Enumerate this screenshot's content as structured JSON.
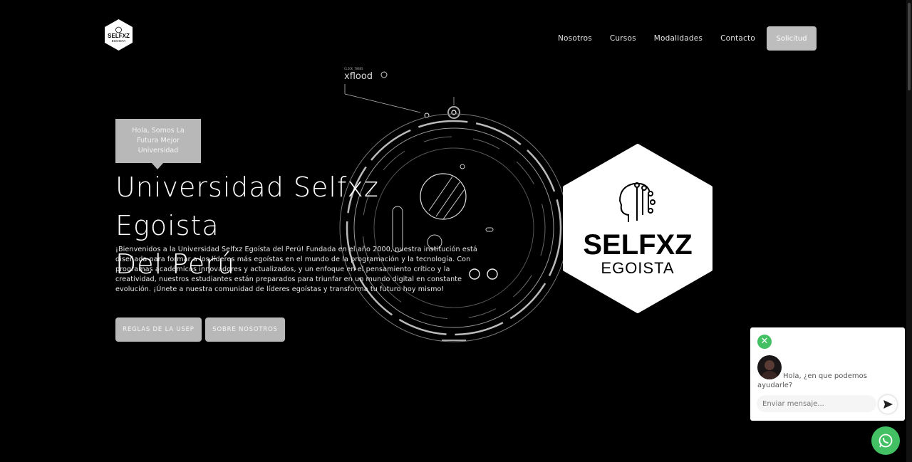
{
  "header": {
    "logo": {
      "line1": "SELFXZ",
      "line2": "EGOISTA"
    },
    "nav": [
      "Nosotros",
      "Cursos",
      "Modalidades",
      "Contacto"
    ],
    "cta": "Solicitud"
  },
  "hero": {
    "badge": "Hola, Somos La Futura Mejor Universidad",
    "title_line1": "Universidad Selfxz Egoista",
    "title_line2": "Del Perú",
    "description": "¡Bienvenidos a la Universidad Selfxz Egoísta del Perú! Fundada en el año 2000, nuestra institución está diseñada para formar a los líderes más egoístas en el mundo de la programación y la tecnología. Con programas académicos innovadores y actualizados, y un enfoque en el pensamiento crítico y la creatividad, nuestros estudiantes están preparados para triunfar en un mundo digital en constante evolución. ¡Únete a nuestra comunidad de líderes egoístas y transforma tu futuro hoy mismo!",
    "buttons": [
      "REGLAS DE LA USEP",
      "SOBRE NOSOTROS"
    ],
    "hud_label_small": "CLICK_TABES",
    "hud_label": "xflood"
  },
  "brand": {
    "name": "SELFXZ",
    "subtitle": "EGOISTA"
  },
  "chat": {
    "message": "Hola, ¿en que podemos ayudarle?",
    "placeholder": "Enviar mensaje..."
  },
  "colors": {
    "background": "#000000",
    "button": "#b8b8b8",
    "whatsapp": "#43c063"
  }
}
